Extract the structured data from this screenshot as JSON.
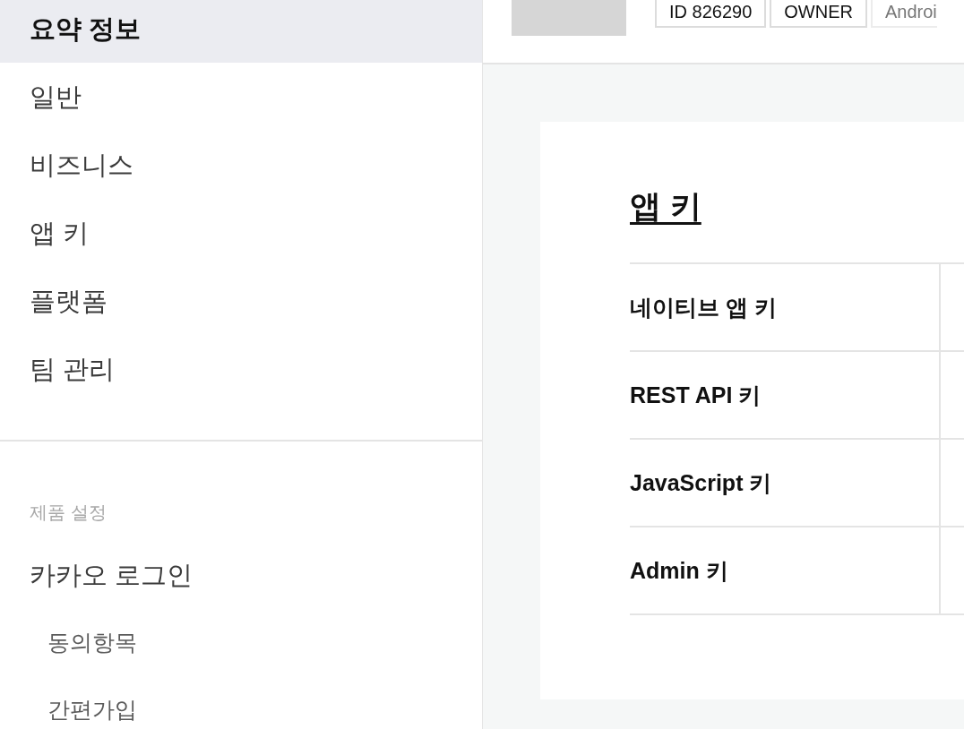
{
  "sidebar": {
    "items": [
      {
        "label": "요약 정보",
        "selected": true
      },
      {
        "label": "일반",
        "selected": false
      },
      {
        "label": "비즈니스",
        "selected": false
      },
      {
        "label": "앱 키",
        "selected": false
      },
      {
        "label": "플랫폼",
        "selected": false
      },
      {
        "label": "팀 관리",
        "selected": false
      }
    ],
    "sections": [
      {
        "title": "제품 설정",
        "items": [
          {
            "label": "카카오 로그인",
            "selected": false,
            "children": [
              {
                "label": "동의항목",
                "selected": false
              },
              {
                "label": "간편가입",
                "selected": false
              }
            ]
          }
        ]
      }
    ]
  },
  "header": {
    "badges": [
      {
        "label": "ID 826290",
        "muted": false
      },
      {
        "label": "OWNER",
        "muted": false
      },
      {
        "label": "Androi",
        "muted": true
      }
    ]
  },
  "app_keys": {
    "title": "앱 키",
    "table": {
      "rows": [
        {
          "label": "네이티브 앱 키"
        },
        {
          "label": "REST API 키"
        },
        {
          "label": "JavaScript 키"
        },
        {
          "label": "Admin 키"
        }
      ]
    }
  }
}
